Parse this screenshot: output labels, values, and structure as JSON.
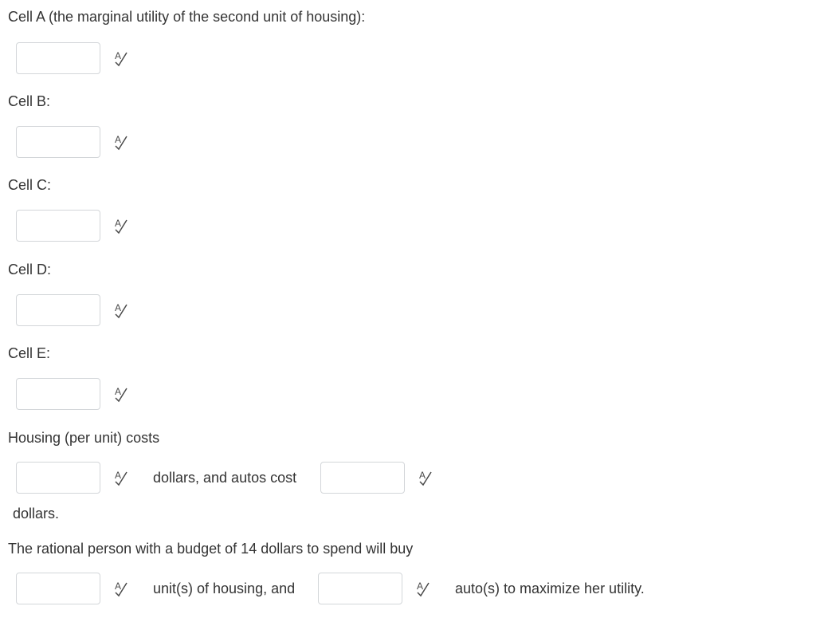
{
  "questions": {
    "cell_a": {
      "label": "Cell A (the marginal utility of the second unit of housing):",
      "value": ""
    },
    "cell_b": {
      "label": "Cell B:",
      "value": ""
    },
    "cell_c": {
      "label": "Cell C:",
      "value": ""
    },
    "cell_d": {
      "label": "Cell D:",
      "value": ""
    },
    "cell_e": {
      "label": "Cell E:",
      "value": ""
    }
  },
  "costs": {
    "intro": "Housing (per unit) costs",
    "between": "dollars, and autos cost",
    "trailing": "dollars.",
    "housing_value": "",
    "autos_value": ""
  },
  "budget": {
    "intro": "The rational person with a budget of 14 dollars to spend will buy",
    "between": "unit(s) of housing, and",
    "trailing": "auto(s) to maximize her utility.",
    "housing_units_value": "",
    "auto_units_value": ""
  },
  "icons": {
    "spell_check": "spell-check-icon"
  },
  "colors": {
    "text": "#333333",
    "input_border": "#d3d6d9",
    "icon": "#4a4a4a"
  }
}
